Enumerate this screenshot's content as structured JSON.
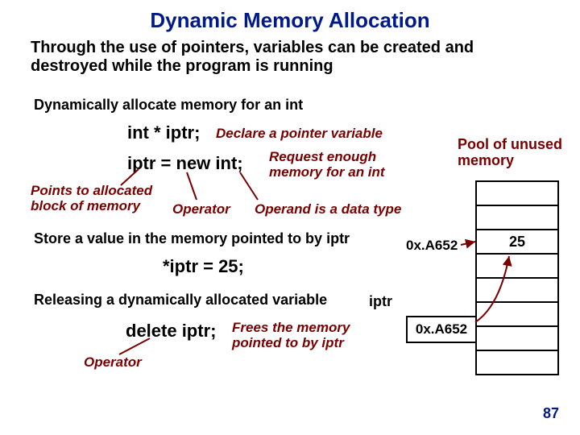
{
  "title": "Dynamic Memory Allocation",
  "intro": "Through the use of pointers, variables can be created and destroyed while the program is running",
  "sec1": "Dynamically allocate memory for an int",
  "decl": "int * iptr;",
  "declnote": "Declare a pointer variable",
  "newexpr": "iptr = new int;",
  "reqnote": "Request enough memory for an int",
  "pointsnote": "Points to allocated block of memory",
  "operator1": "Operator",
  "operand1": "Operand is a data type",
  "sec2": "Store a value in the memory pointed to by iptr",
  "assign": "*iptr = 25;",
  "sec3": "Releasing a dynamically allocated variable",
  "deleteexpr": "delete iptr;",
  "freesnote": "Frees the memory pointed to by iptr",
  "operator2": "Operator",
  "poolhead": "Pool of unused memory",
  "memcell_value": "25",
  "addrlabel": "0x.A652",
  "iptrlabel": "iptr",
  "iptrvalue": "0x.A652",
  "pagenum": "87"
}
